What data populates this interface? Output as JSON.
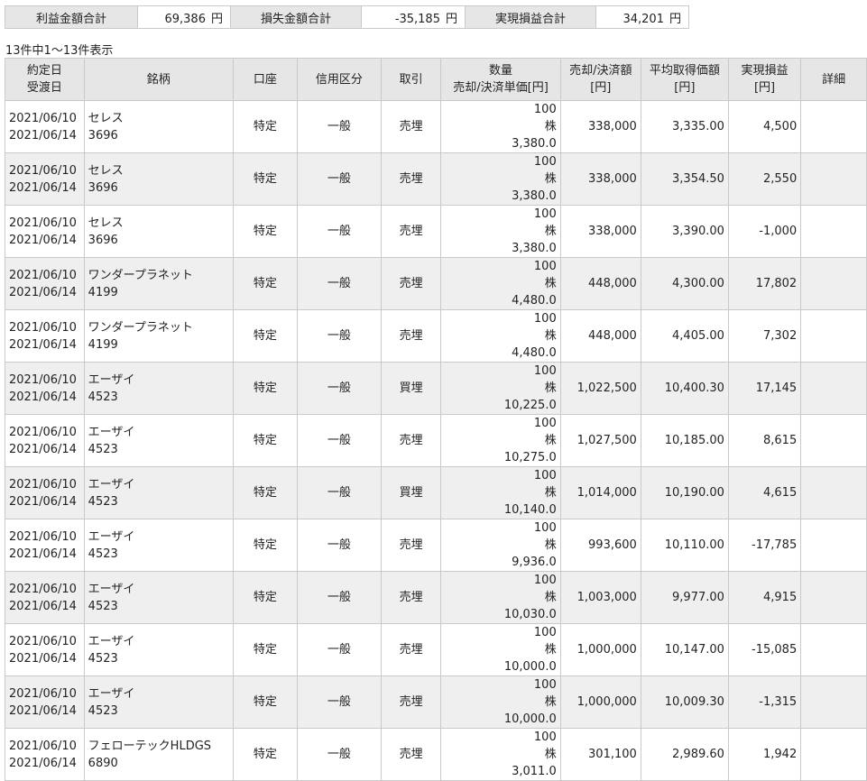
{
  "summary": {
    "profit_label": "利益金額合計",
    "profit_value": "69,386",
    "profit_unit": "円",
    "loss_label": "損失金額合計",
    "loss_value": "-35,185",
    "loss_unit": "円",
    "realized_label": "実現損益合計",
    "realized_value": "34,201",
    "realized_unit": "円"
  },
  "count_text": "13件中1～13件表示",
  "header": {
    "date1": "約定日",
    "date2": "受渡日",
    "stock": "銘柄",
    "account": "口座",
    "credit": "信用区分",
    "trade": "取引",
    "qty1": "数量",
    "qty2": "売却/決済単価[円]",
    "amount1": "売却/決済額",
    "amount2": "[円]",
    "avg1": "平均取得価額",
    "avg2": "[円]",
    "pl1": "実現損益",
    "pl2": "[円]",
    "detail": "詳細"
  },
  "rows": [
    {
      "trade_date": "2021/06/10",
      "settle_date": "2021/06/14",
      "name": "セレス",
      "code": "3696",
      "account": "特定",
      "credit": "一般",
      "trade": "売埋",
      "qty": "100",
      "unit": "株",
      "price": "3,380.0",
      "amount": "338,000",
      "avg": "3,335.00",
      "pl": "4,500"
    },
    {
      "trade_date": "2021/06/10",
      "settle_date": "2021/06/14",
      "name": "セレス",
      "code": "3696",
      "account": "特定",
      "credit": "一般",
      "trade": "売埋",
      "qty": "100",
      "unit": "株",
      "price": "3,380.0",
      "amount": "338,000",
      "avg": "3,354.50",
      "pl": "2,550"
    },
    {
      "trade_date": "2021/06/10",
      "settle_date": "2021/06/14",
      "name": "セレス",
      "code": "3696",
      "account": "特定",
      "credit": "一般",
      "trade": "売埋",
      "qty": "100",
      "unit": "株",
      "price": "3,380.0",
      "amount": "338,000",
      "avg": "3,390.00",
      "pl": "-1,000"
    },
    {
      "trade_date": "2021/06/10",
      "settle_date": "2021/06/14",
      "name": "ワンダープラネット",
      "code": "4199",
      "account": "特定",
      "credit": "一般",
      "trade": "売埋",
      "qty": "100",
      "unit": "株",
      "price": "4,480.0",
      "amount": "448,000",
      "avg": "4,300.00",
      "pl": "17,802"
    },
    {
      "trade_date": "2021/06/10",
      "settle_date": "2021/06/14",
      "name": "ワンダープラネット",
      "code": "4199",
      "account": "特定",
      "credit": "一般",
      "trade": "売埋",
      "qty": "100",
      "unit": "株",
      "price": "4,480.0",
      "amount": "448,000",
      "avg": "4,405.00",
      "pl": "7,302"
    },
    {
      "trade_date": "2021/06/10",
      "settle_date": "2021/06/14",
      "name": "エーザイ",
      "code": "4523",
      "account": "特定",
      "credit": "一般",
      "trade": "買埋",
      "qty": "100",
      "unit": "株",
      "price": "10,225.0",
      "amount": "1,022,500",
      "avg": "10,400.30",
      "pl": "17,145"
    },
    {
      "trade_date": "2021/06/10",
      "settle_date": "2021/06/14",
      "name": "エーザイ",
      "code": "4523",
      "account": "特定",
      "credit": "一般",
      "trade": "売埋",
      "qty": "100",
      "unit": "株",
      "price": "10,275.0",
      "amount": "1,027,500",
      "avg": "10,185.00",
      "pl": "8,615"
    },
    {
      "trade_date": "2021/06/10",
      "settle_date": "2021/06/14",
      "name": "エーザイ",
      "code": "4523",
      "account": "特定",
      "credit": "一般",
      "trade": "買埋",
      "qty": "100",
      "unit": "株",
      "price": "10,140.0",
      "amount": "1,014,000",
      "avg": "10,190.00",
      "pl": "4,615"
    },
    {
      "trade_date": "2021/06/10",
      "settle_date": "2021/06/14",
      "name": "エーザイ",
      "code": "4523",
      "account": "特定",
      "credit": "一般",
      "trade": "売埋",
      "qty": "100",
      "unit": "株",
      "price": "9,936.0",
      "amount": "993,600",
      "avg": "10,110.00",
      "pl": "-17,785"
    },
    {
      "trade_date": "2021/06/10",
      "settle_date": "2021/06/14",
      "name": "エーザイ",
      "code": "4523",
      "account": "特定",
      "credit": "一般",
      "trade": "売埋",
      "qty": "100",
      "unit": "株",
      "price": "10,030.0",
      "amount": "1,003,000",
      "avg": "9,977.00",
      "pl": "4,915"
    },
    {
      "trade_date": "2021/06/10",
      "settle_date": "2021/06/14",
      "name": "エーザイ",
      "code": "4523",
      "account": "特定",
      "credit": "一般",
      "trade": "売埋",
      "qty": "100",
      "unit": "株",
      "price": "10,000.0",
      "amount": "1,000,000",
      "avg": "10,147.00",
      "pl": "-15,085"
    },
    {
      "trade_date": "2021/06/10",
      "settle_date": "2021/06/14",
      "name": "エーザイ",
      "code": "4523",
      "account": "特定",
      "credit": "一般",
      "trade": "売埋",
      "qty": "100",
      "unit": "株",
      "price": "10,000.0",
      "amount": "1,000,000",
      "avg": "10,009.30",
      "pl": "-1,315"
    },
    {
      "trade_date": "2021/06/10",
      "settle_date": "2021/06/14",
      "name": "フェローテックHLDGS",
      "code": "6890",
      "account": "特定",
      "credit": "一般",
      "trade": "売埋",
      "qty": "100",
      "unit": "株",
      "price": "3,011.0",
      "amount": "301,100",
      "avg": "2,989.60",
      "pl": "1,942"
    }
  ]
}
